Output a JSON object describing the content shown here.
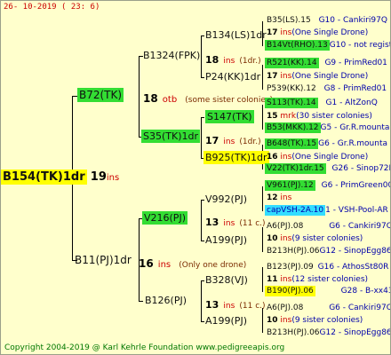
{
  "header": "26- 10-2019 ( 23: 6)",
  "footer": "Copyright 2004-2019 @ Karl Kehrle Foundation    www.pedigreeapis.org",
  "colors": {
    "background": "#ffffcc",
    "green_highlight": "#33dd33",
    "yellow_highlight": "#ffff00",
    "cyan_highlight": "#33ddff",
    "red_text": "#cc0000",
    "blue_text": "#0000aa",
    "footer_green": "#007700"
  },
  "gen0": {
    "name": "B154(TK)1dr",
    "drones": "19",
    "unit": "ins"
  },
  "gen1": [
    {
      "name": "B72(TK)",
      "drones": "18",
      "unit": "otb",
      "note": "(some sister colonies)"
    },
    {
      "name": "B11(PJ)1dr",
      "drones": "16",
      "unit": "ins",
      "note": "(Only one drone)"
    }
  ],
  "gen2": [
    {
      "name": "B1324(FPK)",
      "drones": "18",
      "unit": "ins",
      "note": "(1dr.)"
    },
    {
      "name": "S35(TK)1dr",
      "drones": "17",
      "unit": "ins",
      "note": "(1dr.)"
    },
    {
      "name": "V216(PJ)",
      "drones": "13",
      "unit": "ins",
      "note": "(11 c.)"
    },
    {
      "name": "B126(PJ)",
      "drones": "13",
      "unit": "ins",
      "note": "(11 c.)"
    }
  ],
  "gen3": [
    {
      "name": "B134(LS)1dr"
    },
    {
      "name": "P24(KK)1dr"
    },
    {
      "name": "S147(TK)"
    },
    {
      "name": "B925(TK)1dr"
    },
    {
      "name": "V992(PJ)"
    },
    {
      "name": "A199(PJ)"
    },
    {
      "name": "B328(VJ)"
    },
    {
      "name": "A199(PJ)"
    }
  ],
  "gen4": [
    {
      "name": "B35(LS).15",
      "info": "G10 - Cankiri97Q",
      "count": "17",
      "unit": "ins",
      "note": "(One Single Drone)"
    },
    {
      "name": "B14Vt(RHO).13",
      "info": "G10 - not registe"
    },
    {
      "name": "R521(KK).14",
      "info": "G9 - PrimRed01",
      "count": "17",
      "unit": "ins",
      "note": "(One Single Drone)"
    },
    {
      "name": "P539(KK).12",
      "info": "G8 - PrimRed01"
    },
    {
      "name": "S113(TK).14",
      "info": "G1 - AltZonQ",
      "count": "15",
      "unit": "mrk",
      "note": "(30 sister colonies)"
    },
    {
      "name": "B53(MKK).12",
      "info": "G5 - Gr.R.mounta"
    },
    {
      "name": "B648(TK).15",
      "info": "G6 - Gr.R.mounta",
      "count": "16",
      "unit": "ins",
      "note": "(One Single Drone)"
    },
    {
      "name": "V22(TK)1dr.15",
      "info": "G26 - Sinop72R"
    },
    {
      "name": "V961(PJ).12",
      "info": "G6 - PrimGreen00",
      "count": "12",
      "unit": "ins",
      "note": ""
    },
    {
      "name": "capVSH-2A.10",
      "info": "1 - VSH-Pool-AR"
    },
    {
      "name": "A6(PJ).08",
      "info": "G6 - Cankiri97Q",
      "count": "10",
      "unit": "ins",
      "note": "(9 sister colonies)"
    },
    {
      "name": "B213H(PJ).06",
      "info": "G12 - SinopEgg86R"
    },
    {
      "name": "B123(PJ).09",
      "info": "G16 - AthosSt80R",
      "count": "11",
      "unit": "ins",
      "note": "(12 sister colonies)"
    },
    {
      "name": "B190(PJ).06",
      "info": "G28 - B-xx43"
    },
    {
      "name": "A6(PJ).08",
      "info": "G6 - Cankiri97Q",
      "count": "10",
      "unit": "ins",
      "note": "(9 sister colonies)"
    },
    {
      "name": "B213H(PJ).06",
      "info": "G12 - SinopEgg86R"
    }
  ]
}
